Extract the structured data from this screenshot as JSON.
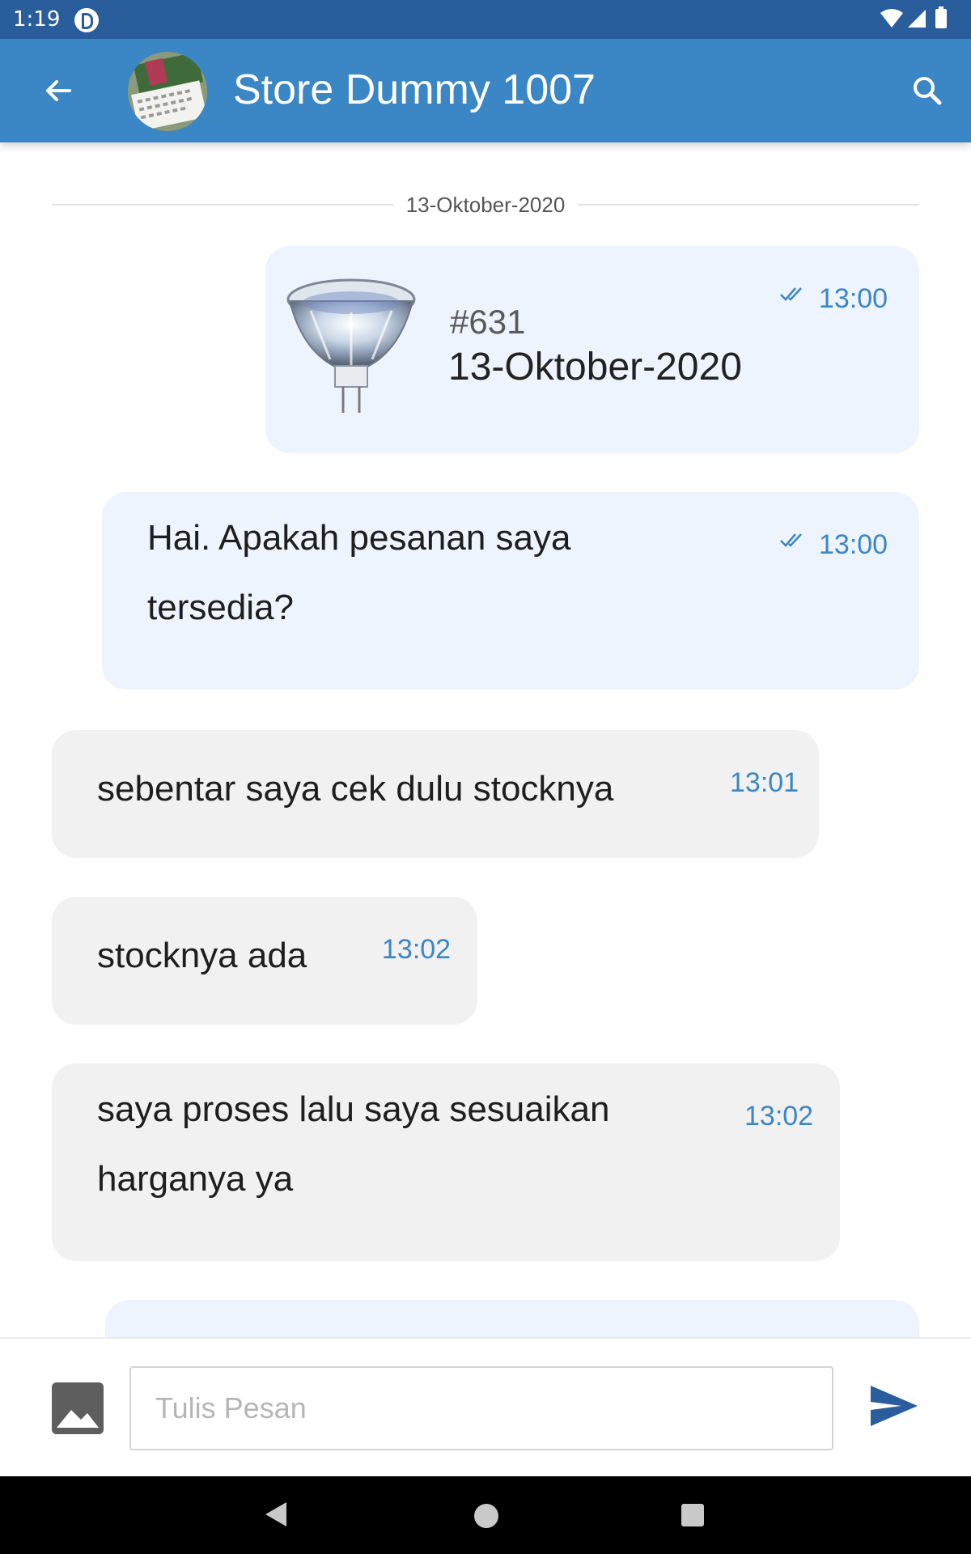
{
  "status_bar": {
    "time": "1:19"
  },
  "header": {
    "title": "Store Dummy 1007",
    "back_icon": "arrow-left-icon",
    "search_icon": "search-icon"
  },
  "chat": {
    "date_divider": "13-Oktober-2020",
    "order_card": {
      "order_number": "#631",
      "order_date": "13-Oktober-2020",
      "time": "13:00",
      "status_icon": "double-check-icon"
    },
    "messages": [
      {
        "direction": "out",
        "lines": [
          "Hai. Apakah pesanan saya",
          "tersedia?"
        ],
        "time": "13:00",
        "status_icon": "double-check-icon"
      },
      {
        "direction": "in",
        "lines": [
          "sebentar saya cek dulu stocknya"
        ],
        "time": "13:01"
      },
      {
        "direction": "in",
        "lines": [
          "stocknya ada"
        ],
        "time": "13:02"
      },
      {
        "direction": "in",
        "lines": [
          "saya proses lalu saya sesuaikan",
          "harganya ya"
        ],
        "time": "13:02"
      }
    ]
  },
  "input": {
    "placeholder": "Tulis Pesan",
    "value": "",
    "gallery_icon": "image-icon",
    "send_icon": "send-icon"
  },
  "colors": {
    "primary": "#3b86c4",
    "status_bar": "#2a5d9c",
    "outgoing_bubble": "#eef4fd",
    "incoming_bubble": "#f1f1f1"
  }
}
